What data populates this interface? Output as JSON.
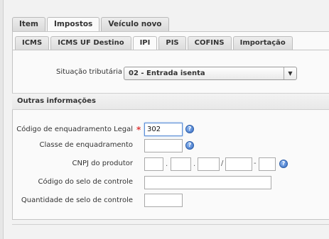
{
  "outer_tabs": [
    {
      "label": "Item"
    },
    {
      "label": "Impostos"
    },
    {
      "label": "Veículo novo"
    }
  ],
  "inner_tabs": [
    {
      "label": "ICMS"
    },
    {
      "label": "ICMS UF Destino"
    },
    {
      "label": "IPI"
    },
    {
      "label": "PIS"
    },
    {
      "label": "COFINS"
    },
    {
      "label": "Importação"
    }
  ],
  "situacao": {
    "label": "Situação tributária",
    "selected": "02 - Entrada isenta"
  },
  "section_title": "Outras informações",
  "fields": {
    "codigo_enquadramento": {
      "label": "Código de enquadramento Legal",
      "value": "302",
      "required_marker": "*"
    },
    "classe_enquadramento": {
      "label": "Classe de enquadramento",
      "value": ""
    },
    "cnpj_produtor": {
      "label": "CNPJ do produtor",
      "sep_dot": ".",
      "sep_slash": "/",
      "sep_dash": "-"
    },
    "codigo_selo": {
      "label": "Código do selo de controle",
      "value": ""
    },
    "quantidade_selo": {
      "label": "Quantidade de selo de controle",
      "value": ""
    }
  },
  "colors": {
    "accent": "#3a6fc4",
    "required": "#e03a3a"
  }
}
